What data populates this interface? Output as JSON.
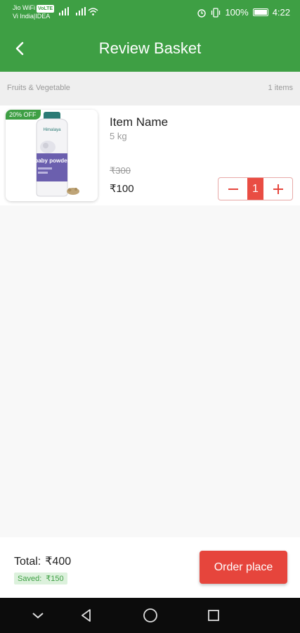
{
  "status_bar": {
    "carrier_1": "Jio WiFi",
    "volte_badge": "VoLTE",
    "carrier_2": "Vi India|IDEA",
    "battery_percent": "100%",
    "time": "4:22"
  },
  "header": {
    "title": "Review Basket"
  },
  "category": {
    "name": "Fruits & Vegetable",
    "count": "1 items"
  },
  "items": [
    {
      "discount": "20% OFF",
      "product_brand": "Himalaya",
      "product_label": "baby powder",
      "name": "Item Name",
      "weight": "5 kg",
      "original_price": "₹300",
      "price": "₹100",
      "quantity": "1"
    }
  ],
  "footer": {
    "total_label": "Total:",
    "total_value": "₹400",
    "saved_label": "Saved:",
    "saved_value": "₹150",
    "order_button": "Order place"
  },
  "colors": {
    "brand_green": "#3e9f44",
    "accent_red": "#e6453c"
  },
  "icons": {
    "back": "arrow-back-icon",
    "minus": "minus-icon",
    "plus": "plus-icon",
    "nav_hide": "chevron-down-icon",
    "nav_back": "triangle-back-icon",
    "nav_home": "circle-home-icon",
    "nav_recents": "square-recents-icon"
  }
}
